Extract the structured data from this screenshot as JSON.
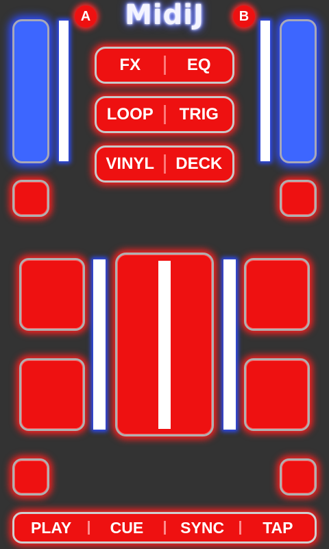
{
  "app": {
    "logo": "MidiJ"
  },
  "decks": {
    "left_label": "A",
    "right_label": "B"
  },
  "mode_buttons": [
    {
      "left": "FX",
      "right": "EQ"
    },
    {
      "left": "LOOP",
      "right": "TRIG"
    },
    {
      "left": "VINYL",
      "right": "DECK"
    }
  ],
  "transport": {
    "play": "PLAY",
    "cue": "CUE",
    "sync": "SYNC",
    "tap": "TAP"
  },
  "colors": {
    "background": "#333333",
    "pad_red": "#ee1111",
    "fader_blue": "#3d66ff",
    "glow_blue": "#2e4dff",
    "glow_red": "#ff2020"
  },
  "icons": {
    "crossfader_handle": "white-bar",
    "pitch_indicator": "white-bar"
  }
}
